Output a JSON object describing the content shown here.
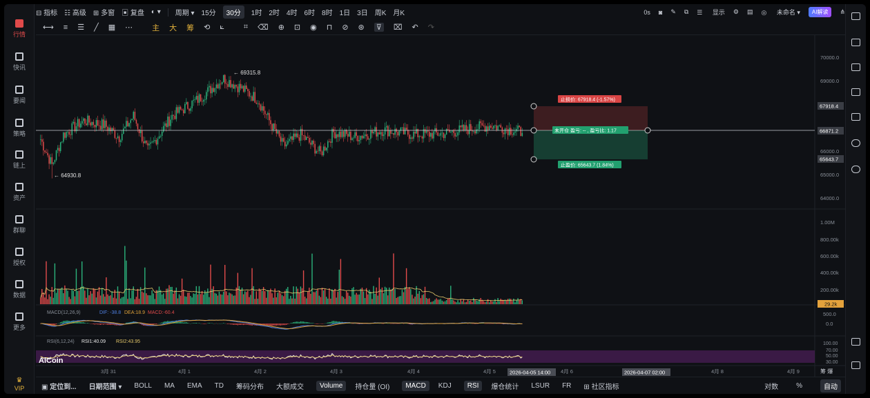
{
  "sidebar": {
    "items": [
      {
        "label": "行情"
      },
      {
        "label": "快讯"
      },
      {
        "label": "要闻"
      },
      {
        "label": "策略"
      },
      {
        "label": "链上"
      },
      {
        "label": "资产"
      },
      {
        "label": "群聊"
      },
      {
        "label": "授权"
      },
      {
        "label": "数据"
      },
      {
        "label": "更多"
      }
    ],
    "vip": "VIP"
  },
  "toolbar": {
    "indicator": "指标",
    "advanced": "高级",
    "multiwindow": "多窗",
    "replay": "复盘",
    "period": "周期",
    "intervals": [
      "15分",
      "30分",
      "1时",
      "2时",
      "4时",
      "6时",
      "8时",
      "1日",
      "3日",
      "周K",
      "月K"
    ],
    "selected_interval": "30分",
    "countdown": "0s",
    "display": "显示",
    "user": "未命名",
    "ai": "AI解读"
  },
  "draw_toolbar": {
    "main": "主",
    "big": "大",
    "chip": "筹"
  },
  "price_axis": [
    "70000.0",
    "69000.0",
    "67000.0",
    "66000.0",
    "65000.0",
    "64000.0"
  ],
  "price_tags": {
    "tp": "67918.4",
    "current": "66871.2",
    "sl": "65643.7",
    "vol": "29.2k"
  },
  "annotations": {
    "high": "← 69315.8",
    "low": "← 64930.8",
    "tp_label": "止损价: 67918.4 (-1.57%)",
    "position_label": "未开仓 盈亏: -- , 盈亏比: 1.17",
    "sl_label": "止盈价: 65643.7 (1.84%)"
  },
  "volume_axis": [
    "1.00M",
    "800.00k",
    "600.00k",
    "400.00k",
    "200.00k"
  ],
  "macd": {
    "label": "MACD(12,26,9)",
    "dif": "DIF: -38.8",
    "dea": "DEA:18.9",
    "macd": "MACD:-60.4",
    "axis": [
      "500.0",
      "0.0"
    ]
  },
  "rsi": {
    "label": "RSI(6,12,24)",
    "rsi1": "RSI1:40.09",
    "rsi2": "RSI2:43.95",
    "axis": [
      "100.00",
      "70.00",
      "50.00",
      "30.00"
    ]
  },
  "time_axis": [
    "3月 31",
    "4月 1",
    "4月 2",
    "4月 3",
    "4月 4",
    "4月 5",
    "4月 6",
    "4月 7",
    "4月 8",
    "4月 9"
  ],
  "time_tags": [
    "2026-04-05 14:00",
    "2026-04-07 02:00"
  ],
  "logo": "AiCoin",
  "bottom": {
    "locate": "定位到...",
    "daterange": "日期范围",
    "items": [
      "BOLL",
      "MA",
      "EMA",
      "TD",
      "筹码分布",
      "大额成交",
      "Volume",
      "持仓量 (OI)",
      "MACD",
      "KDJ",
      "RSI",
      "爆仓统计",
      "LSUR",
      "FR",
      "社区指标"
    ],
    "active": [
      "Volume",
      "MACD",
      "RSI"
    ],
    "right": [
      "对数",
      "%",
      "自动"
    ],
    "chips": "筹 爆"
  },
  "colors": {
    "up": "#2bb37c",
    "down": "#e24b4b",
    "accent": "#e4b23c",
    "bg": "#0f1115"
  },
  "chart_data": {
    "type": "candlestick",
    "symbol_interval": "30分",
    "y_range": [
      63800,
      70400
    ],
    "high": 69315.8,
    "low": 64930.8,
    "last": 66871.2,
    "take_profit": 67918.4,
    "stop_loss": 65643.7,
    "path_keypoints": [
      {
        "t": 0,
        "p": 66600
      },
      {
        "t": 8,
        "p": 65500
      },
      {
        "t": 16,
        "p": 66800
      },
      {
        "t": 30,
        "p": 67400
      },
      {
        "t": 45,
        "p": 67200
      },
      {
        "t": 55,
        "p": 66700
      },
      {
        "t": 65,
        "p": 67600
      },
      {
        "t": 75,
        "p": 66100
      },
      {
        "t": 92,
        "p": 67600
      },
      {
        "t": 110,
        "p": 68300
      },
      {
        "t": 128,
        "p": 69200
      },
      {
        "t": 140,
        "p": 68800
      },
      {
        "t": 152,
        "p": 68300
      },
      {
        "t": 160,
        "p": 67400
      },
      {
        "t": 170,
        "p": 66300
      },
      {
        "t": 182,
        "p": 66800
      },
      {
        "t": 196,
        "p": 66000
      },
      {
        "t": 205,
        "p": 66900
      },
      {
        "t": 220,
        "p": 66700
      },
      {
        "t": 240,
        "p": 67000
      },
      {
        "t": 262,
        "p": 66800
      },
      {
        "t": 282,
        "p": 66850
      },
      {
        "t": 300,
        "p": 67050
      },
      {
        "t": 315,
        "p": 67200
      },
      {
        "t": 330,
        "p": 67000
      },
      {
        "t": 337,
        "p": 66900
      }
    ]
  }
}
